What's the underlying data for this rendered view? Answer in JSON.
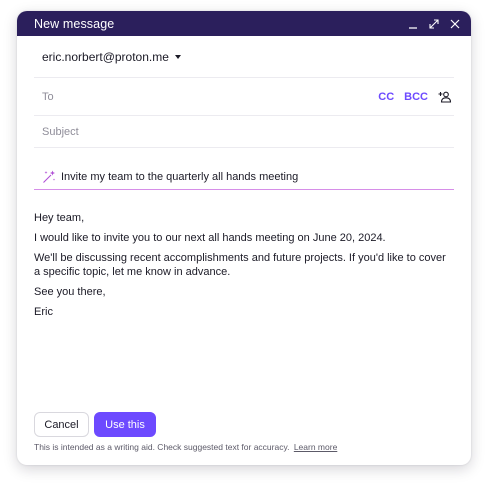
{
  "window": {
    "title": "New message"
  },
  "from": {
    "address": "eric.norbert@proton.me"
  },
  "to": {
    "placeholder": "To",
    "cc_label": "CC",
    "bcc_label": "BCC"
  },
  "subject": {
    "placeholder": "Subject"
  },
  "assistant": {
    "prompt": "Invite my team to the quarterly all hands meeting"
  },
  "message": {
    "paragraphs": [
      "Hey team,",
      "I would like to invite you to our next all hands meeting on June 20, 2024.",
      "We'll be discussing recent accomplishments and future projects. If you'd like to cover a specific topic, let me know in advance.",
      "See you there,",
      "Eric"
    ]
  },
  "actions": {
    "cancel_label": "Cancel",
    "use_label": "Use this"
  },
  "footer": {
    "disclaimer": "This is intended as a writing aid. Check suggested text for accuracy.",
    "learn_more": "Learn more"
  },
  "colors": {
    "titlebar": "#2b1f5c",
    "accent": "#6d4aff",
    "prompt_underline": "#d68ee8"
  },
  "icons": {
    "minimize": "minimize-icon",
    "expand": "expand-icon",
    "close": "close-icon",
    "add_contact": "add-contact-icon",
    "sparkle": "sparkle-icon",
    "from_dropdown": "chevron-down-icon"
  }
}
